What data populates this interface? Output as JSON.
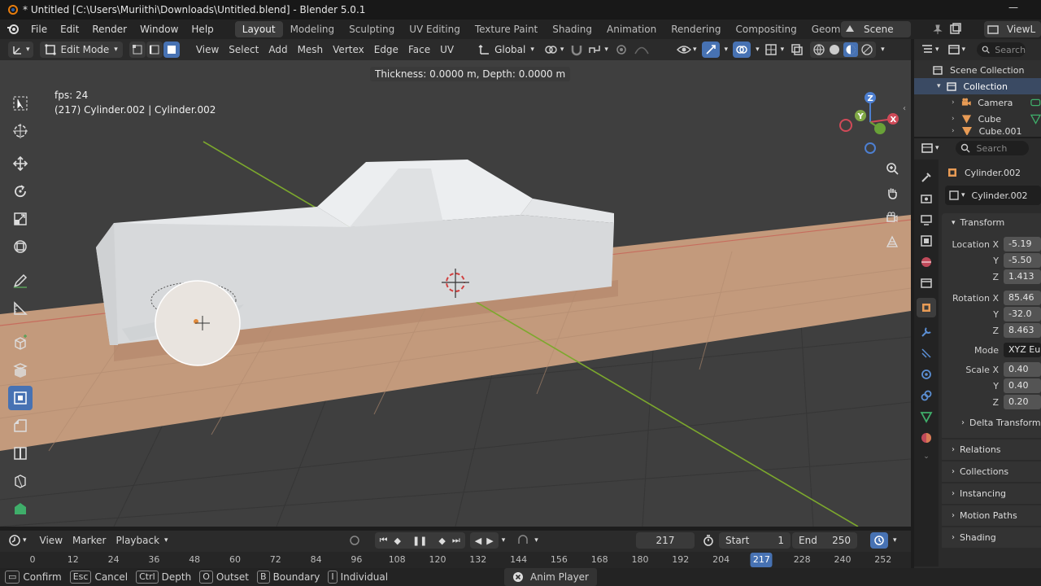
{
  "titlebar": {
    "title": "* Untitled [C:\\Users\\Muriithi\\Downloads\\Untitled.blend] - Blender 5.0.1",
    "minimize": "—"
  },
  "menu": [
    "File",
    "Edit",
    "Render",
    "Window",
    "Help"
  ],
  "workspaces": [
    "Layout",
    "Modeling",
    "Sculpting",
    "UV Editing",
    "Texture Paint",
    "Shading",
    "Animation",
    "Rendering",
    "Compositing",
    "Geometry Nodes"
  ],
  "scene": {
    "name": "Scene",
    "view_layer": "ViewL"
  },
  "header": {
    "mode": "Edit Mode",
    "menus": [
      "View",
      "Select",
      "Add",
      "Mesh",
      "Vertex",
      "Edge",
      "Face",
      "UV"
    ],
    "orientation": "Global"
  },
  "viewport": {
    "tool_info": "Thickness: 0.0000 m, Depth: 0.0000 m",
    "fps": "fps: 24",
    "object_info": "(217) Cylinder.002 | Cylinder.002",
    "gizmo_axes": [
      "X",
      "Y",
      "Z"
    ]
  },
  "outliner": {
    "search_placeholder": "Search",
    "items": [
      "Scene Collection",
      "Collection",
      "Camera",
      "Cube",
      "Cube.001"
    ]
  },
  "properties": {
    "search_placeholder": "Search",
    "object_name": "Cylinder.002",
    "data_name": "Cylinder.002",
    "transform_label": "Transform",
    "location": {
      "label_x": "Location X",
      "label_y": "Y",
      "label_z": "Z",
      "x": "-5.19",
      "y": "-5.50",
      "z": "1.413"
    },
    "rotation": {
      "label_x": "Rotation X",
      "label_y": "Y",
      "label_z": "Z",
      "x": "85.46",
      "y": "-32.0",
      "z": "8.463"
    },
    "mode": {
      "label": "Mode",
      "value": "XYZ Eu"
    },
    "scale": {
      "label_x": "Scale X",
      "label_y": "Y",
      "label_z": "Z",
      "x": "0.40",
      "y": "0.40",
      "z": "0.20"
    },
    "panels": [
      "Delta Transform",
      "Relations",
      "Collections",
      "Instancing",
      "Motion Paths",
      "Shading"
    ]
  },
  "timeline": {
    "menus": [
      "View",
      "Marker",
      "Playback"
    ],
    "current_frame": "217",
    "start_label": "Start",
    "start": "1",
    "end_label": "End",
    "end": "250",
    "ruler": [
      "0",
      "12",
      "24",
      "36",
      "48",
      "60",
      "72",
      "84",
      "96",
      "108",
      "120",
      "132",
      "144",
      "156",
      "168",
      "180",
      "192",
      "204",
      "217",
      "228",
      "240",
      "252"
    ]
  },
  "statusbar": {
    "items": [
      {
        "key": "",
        "label": "Confirm"
      },
      {
        "key": "Esc",
        "label": "Cancel"
      },
      {
        "key": "Ctrl",
        "label": "Depth"
      },
      {
        "key": "O",
        "label": "Outset"
      },
      {
        "key": "B",
        "label": "Boundary"
      },
      {
        "key": "I",
        "label": "Individual"
      }
    ],
    "anim_player": "Anim Player"
  },
  "colors": {
    "accent": "#4772b3",
    "floor": "#c39a7c",
    "car": "#d7d9db",
    "grid": "#3f3f3f",
    "x_axis": "#c9403f",
    "y_axis": "#7ca82d"
  }
}
